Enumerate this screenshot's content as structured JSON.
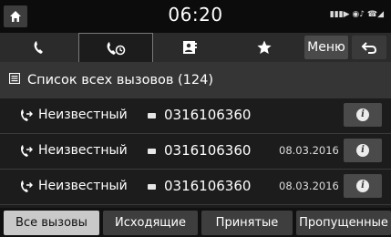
{
  "status_bar": {
    "time": "06:20",
    "icons": "▮▮▮▶ ◉♪ ☎◢"
  },
  "tabs": [
    {
      "name": "tab-dial",
      "icon": "phone-icon"
    },
    {
      "name": "tab-call-history",
      "icon": "call-history-icon"
    },
    {
      "name": "tab-contacts",
      "icon": "contacts-icon"
    },
    {
      "name": "tab-favorites",
      "icon": "star-icon"
    }
  ],
  "toolbar": {
    "menu_label": "Меню"
  },
  "list": {
    "header_icon": "list-icon",
    "title": "Список всех вызовов (124)",
    "rows": [
      {
        "caller": "Неизвестный",
        "number": "0316106360",
        "date": ""
      },
      {
        "caller": "Неизвестный",
        "number": "0316106360",
        "date": "08.03.2016"
      },
      {
        "caller": "Неизвестный",
        "number": "0316106360",
        "date": "08.03.2016"
      }
    ]
  },
  "filters": {
    "all": "Все вызовы",
    "outgoing": "Исходящие",
    "received": "Принятые",
    "missed": "Пропущенные",
    "active": "all"
  }
}
